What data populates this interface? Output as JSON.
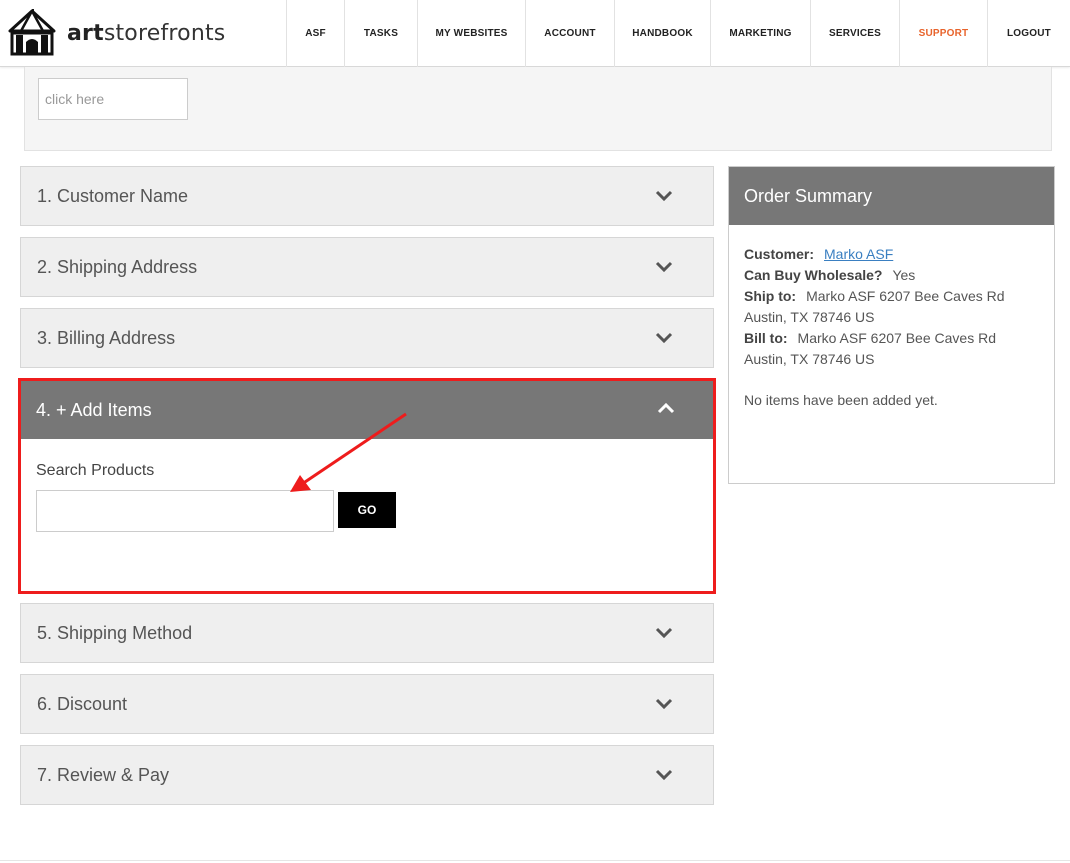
{
  "brand": {
    "prefix": "art",
    "suffix": "storefronts"
  },
  "nav": [
    {
      "label": "ASF"
    },
    {
      "label": "TASKS"
    },
    {
      "label": "MY WEBSITES"
    },
    {
      "label": "ACCOUNT"
    },
    {
      "label": "HANDBOOK"
    },
    {
      "label": "MARKETING"
    },
    {
      "label": "SERVICES"
    },
    {
      "label": "SUPPORT"
    },
    {
      "label": "LOGOUT"
    }
  ],
  "top_panel": {
    "click_here": "click here"
  },
  "sections": [
    {
      "title": "1. Customer Name"
    },
    {
      "title": "2. Shipping Address"
    },
    {
      "title": "3. Billing Address"
    },
    {
      "title": "4. + Add Items"
    },
    {
      "title": "5. Shipping Method"
    },
    {
      "title": "6. Discount"
    },
    {
      "title": "7. Review & Pay"
    }
  ],
  "add_items": {
    "search_label": "Search Products",
    "search_value": "",
    "go_label": "GO"
  },
  "summary": {
    "title": "Order Summary",
    "customer_label": "Customer:",
    "customer_value": "Marko ASF",
    "wholesale_label": "Can Buy Wholesale?",
    "wholesale_value": "Yes",
    "ship_label": "Ship to:",
    "ship_value": "Marko ASF 6207 Bee Caves Rd Austin, TX 78746 US",
    "bill_label": "Bill to:",
    "bill_value": "Marko ASF 6207 Bee Caves Rd Austin, TX 78746 US",
    "no_items": "No items have been added yet."
  },
  "colors": {
    "accent_support": "#e8632b",
    "highlight_red": "#ee1c1c",
    "header_gray": "#777777",
    "link_blue": "#3a7fc1"
  },
  "icons": [
    "tent-logo-icon",
    "chevron-down-icon",
    "chevron-up-icon",
    "annotation-arrow-icon"
  ]
}
